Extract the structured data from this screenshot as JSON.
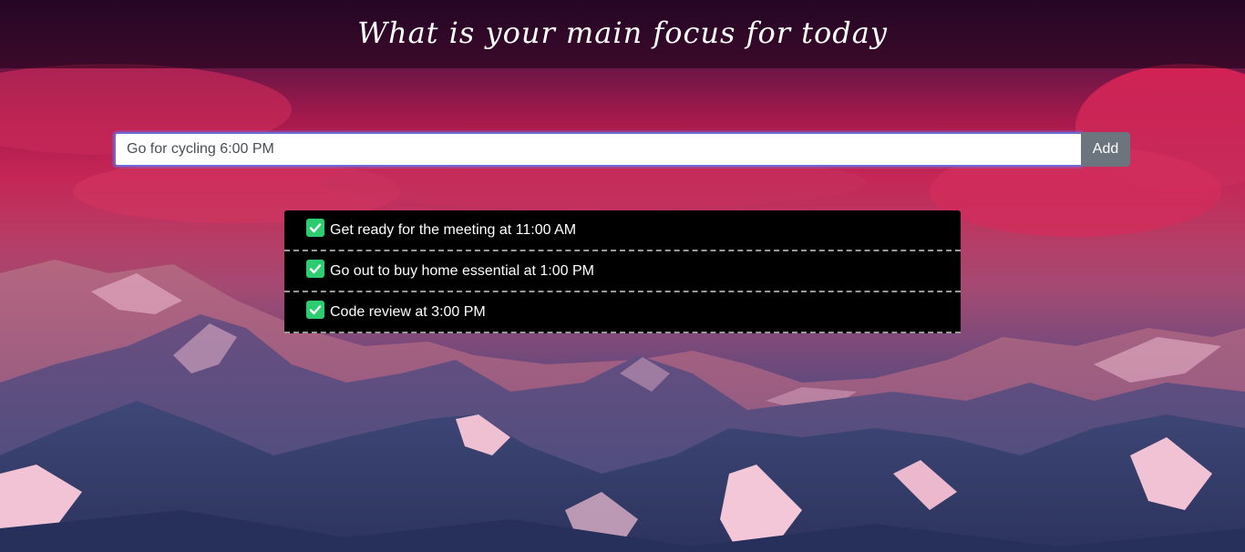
{
  "header": {
    "title": "What is your main focus for today"
  },
  "form": {
    "input_value": "Go for cycling 6:00 PM",
    "add_label": "Add"
  },
  "todos": [
    {
      "text": "Get ready for the meeting at 11:00 AM",
      "done": true
    },
    {
      "text": "Go out to buy home essential at 1:00 PM",
      "done": true
    },
    {
      "text": "Code review at 3:00 PM",
      "done": true
    }
  ],
  "icons": {
    "todo_check": "checkbox-checked-icon"
  },
  "colors": {
    "check": "#2ecc71",
    "add_button": "#6c757d",
    "list_background": "#000000"
  }
}
